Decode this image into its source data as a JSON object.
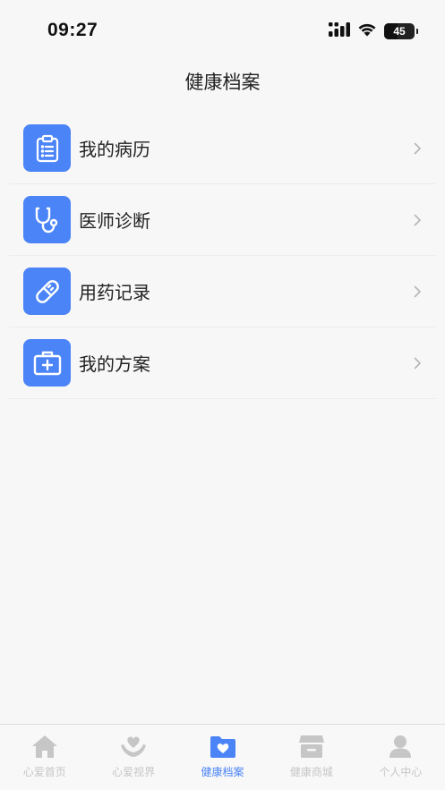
{
  "status_bar": {
    "time": "09:27",
    "battery_percent": "45",
    "battery_level": 0.45
  },
  "header": {
    "title": "健康档案"
  },
  "menu": {
    "items": [
      {
        "label": "我的病历",
        "icon": "clipboard-list-icon"
      },
      {
        "label": "医师诊断",
        "icon": "stethoscope-icon"
      },
      {
        "label": "用药记录",
        "icon": "pill-icon"
      },
      {
        "label": "我的方案",
        "icon": "medical-kit-icon"
      }
    ]
  },
  "tab_bar": {
    "tabs": [
      {
        "label": "心爱首页",
        "icon": "home-icon"
      },
      {
        "label": "心爱视界",
        "icon": "heart-hands-icon"
      },
      {
        "label": "健康档案",
        "icon": "heart-folder-icon",
        "active": true
      },
      {
        "label": "健康商城",
        "icon": "store-icon"
      },
      {
        "label": "个人中心",
        "icon": "user-icon"
      }
    ]
  },
  "colors": {
    "accent": "#4b84f7",
    "inactive": "#c6c6c6",
    "background": "#f7f7f7"
  }
}
